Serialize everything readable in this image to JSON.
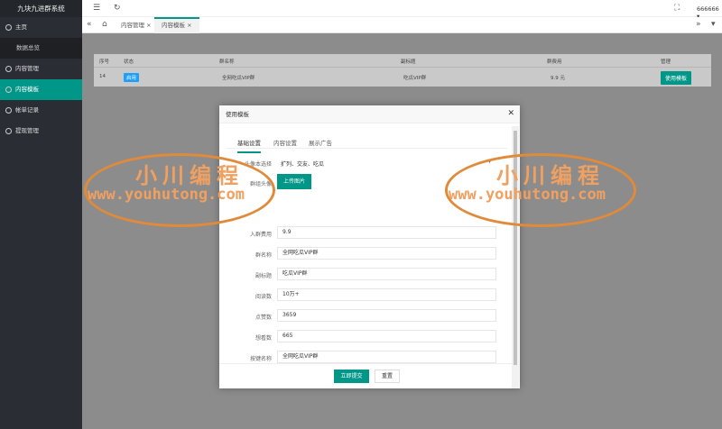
{
  "app": {
    "title": "九块九进群系统",
    "user": "666666"
  },
  "sidebar": {
    "items": [
      {
        "label": "主页"
      },
      {
        "label": "数据总览"
      },
      {
        "label": "内容管理"
      },
      {
        "label": "内容模板"
      },
      {
        "label": "帐单记录"
      },
      {
        "label": "提现管理"
      }
    ]
  },
  "tabs": [
    {
      "label": "内容管理"
    },
    {
      "label": "内容模板"
    }
  ],
  "table": {
    "headers": [
      "序号",
      "状态",
      "群名称",
      "副标题",
      "群费用",
      "管理"
    ],
    "row": {
      "id": "14",
      "status": "启用",
      "name": "全网吃瓜VIP群",
      "subtitle": "吃瓜VIP群",
      "fee": "9.9 元",
      "action": "使用模板"
    }
  },
  "modal": {
    "title": "使用模板",
    "tabs": [
      "基础设置",
      "内容设置",
      "展示广告"
    ],
    "tag_label": "头像本选择",
    "tag_value": "扩列、交友、吃瓜",
    "avatar_label": "群组头像",
    "upload_label": "上传图片",
    "fields": [
      {
        "label": "入群费用",
        "value": "9.9"
      },
      {
        "label": "群名称",
        "value": "全网吃瓜VIP群"
      },
      {
        "label": "副标题",
        "value": "吃瓜VIP群"
      },
      {
        "label": "阅读数",
        "value": "10万+"
      },
      {
        "label": "点赞数",
        "value": "3659"
      },
      {
        "label": "想看数",
        "value": "665"
      },
      {
        "label": "按键名称",
        "value": "全网吃瓜VIP群"
      }
    ],
    "submit_label": "立即提交",
    "reset_label": "重置"
  },
  "watermark": {
    "name": "小川编程",
    "url": "www.youhutong.com"
  }
}
